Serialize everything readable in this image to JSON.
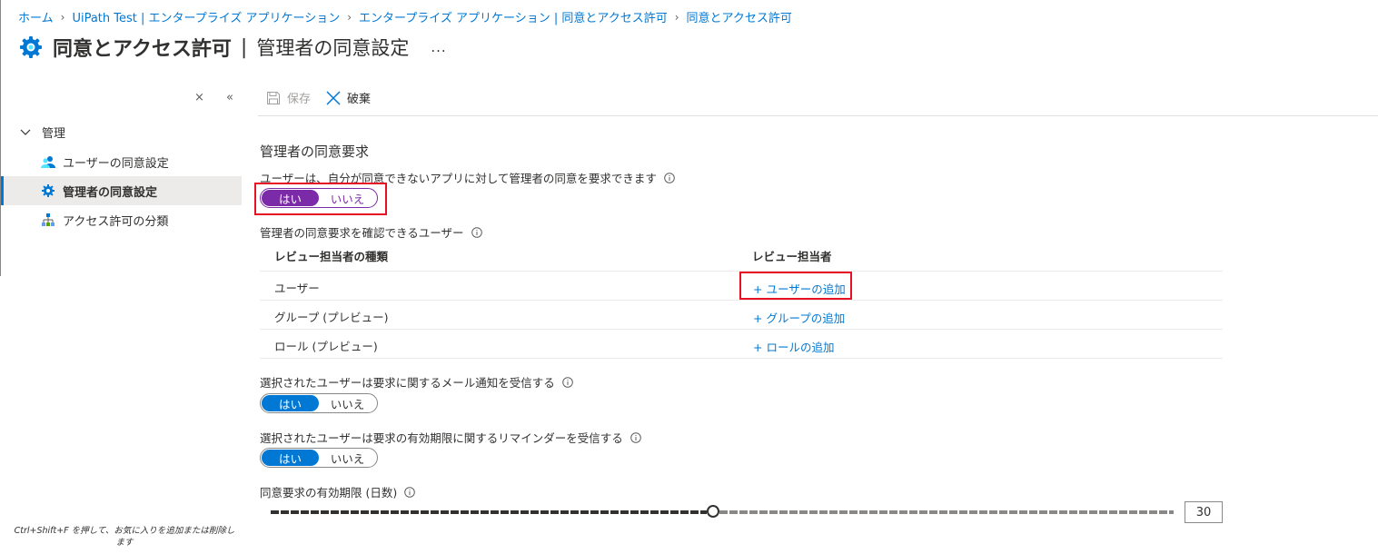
{
  "colors": {
    "accent": "#0078d4",
    "toggle_highlighted": "#7b2aa8",
    "highlight_box": "#e81123"
  },
  "breadcrumb": [
    "ホーム",
    "UiPath Test | エンタープライズ アプリケーション",
    "エンタープライズ アプリケーション | 同意とアクセス許可",
    "同意とアクセス許可"
  ],
  "header": {
    "icon": "gear-icon",
    "title": "同意とアクセス許可",
    "divider": "|",
    "subtitle": "管理者の同意設定",
    "more": "..."
  },
  "sidebar": {
    "collapse_icon": "×",
    "double_chevron_icon": "«",
    "section_label": "管理",
    "items": [
      {
        "label": "ユーザーの同意設定",
        "icon": "users-icon",
        "active": false
      },
      {
        "label": "管理者の同意設定",
        "icon": "gear-icon",
        "active": true
      },
      {
        "label": "アクセス許可の分類",
        "icon": "hierarchy-icon",
        "active": false
      }
    ],
    "footer": "Ctrl+Shift+F を押して、お気に入りを追加または削除します"
  },
  "commands": {
    "save": "保存",
    "discard": "破棄"
  },
  "content": {
    "section_title": "管理者の同意要求",
    "request_label": "ユーザーは、自分が同意できないアプリに対して管理者の同意を要求できます",
    "request_toggle": {
      "yes": "はい",
      "no": "いいえ",
      "selected": "yes"
    },
    "reviewers_label": "管理者の同意要求を確認できるユーザー",
    "table": {
      "headers": [
        "レビュー担当者の種類",
        "レビュー担当者"
      ],
      "rows": [
        {
          "type": "ユーザー",
          "action": "+ ユーザーの追加"
        },
        {
          "type": "グループ (プレビュー)",
          "action": "+ グループの追加"
        },
        {
          "type": "ロール (プレビュー)",
          "action": "+ ロールの追加"
        }
      ]
    },
    "email_label": "選択されたユーザーは要求に関するメール通知を受信する",
    "email_toggle": {
      "yes": "はい",
      "no": "いいえ",
      "selected": "yes"
    },
    "reminder_label": "選択されたユーザーは要求の有効期限に関するリマインダーを受信する",
    "reminder_toggle": {
      "yes": "はい",
      "no": "いいえ",
      "selected": "yes"
    },
    "expiry_label": "同意要求の有効期限 (日数)",
    "expiry_slider": {
      "value": 30,
      "fraction": 0.49
    },
    "expiry_value": "30"
  }
}
